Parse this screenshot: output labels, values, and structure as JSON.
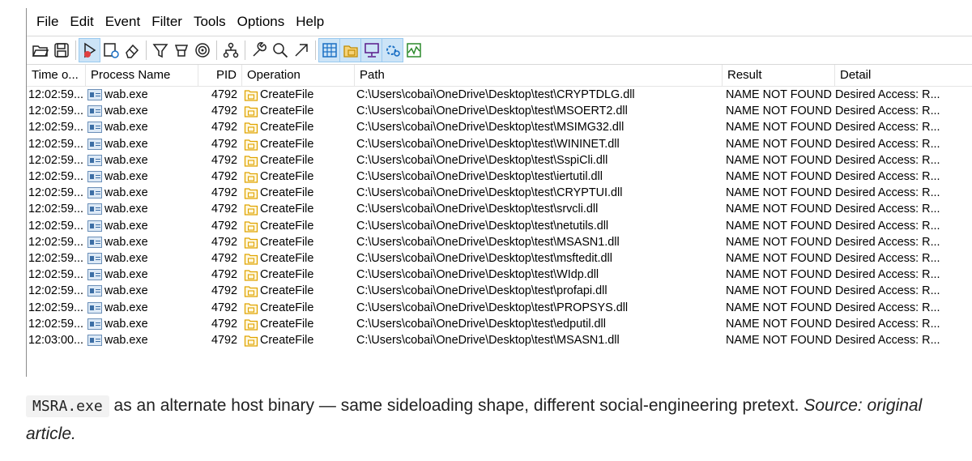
{
  "menu": [
    "File",
    "Edit",
    "Event",
    "Filter",
    "Tools",
    "Options",
    "Help"
  ],
  "toolbar": {
    "icons": [
      "open-folder-icon",
      "save-icon",
      "capture-icon",
      "autoscroll-icon",
      "clear-icon",
      "filter-icon",
      "highlight-icon",
      "target-icon",
      "process-tree-icon",
      "wrench-icon",
      "find-icon",
      "jump-icon",
      "registry-activity-icon",
      "file-activity-icon",
      "network-activity-icon",
      "process-activity-icon",
      "profiling-icon"
    ]
  },
  "columns": {
    "time": "Time o...",
    "process": "Process Name",
    "pid": "PID",
    "operation": "Operation",
    "path": "Path",
    "result": "Result",
    "detail": "Detail"
  },
  "rows": [
    {
      "time": "12:02:59...",
      "process": "wab.exe",
      "pid": "4792",
      "operation": "CreateFile",
      "path": "C:\\Users\\cobai\\OneDrive\\Desktop\\test\\CRYPTDLG.dll",
      "result": "NAME NOT FOUND",
      "detail": "Desired Access: R..."
    },
    {
      "time": "12:02:59...",
      "process": "wab.exe",
      "pid": "4792",
      "operation": "CreateFile",
      "path": "C:\\Users\\cobai\\OneDrive\\Desktop\\test\\MSOERT2.dll",
      "result": "NAME NOT FOUND",
      "detail": "Desired Access: R..."
    },
    {
      "time": "12:02:59...",
      "process": "wab.exe",
      "pid": "4792",
      "operation": "CreateFile",
      "path": "C:\\Users\\cobai\\OneDrive\\Desktop\\test\\MSIMG32.dll",
      "result": "NAME NOT FOUND",
      "detail": "Desired Access: R..."
    },
    {
      "time": "12:02:59...",
      "process": "wab.exe",
      "pid": "4792",
      "operation": "CreateFile",
      "path": "C:\\Users\\cobai\\OneDrive\\Desktop\\test\\WININET.dll",
      "result": "NAME NOT FOUND",
      "detail": "Desired Access: R..."
    },
    {
      "time": "12:02:59...",
      "process": "wab.exe",
      "pid": "4792",
      "operation": "CreateFile",
      "path": "C:\\Users\\cobai\\OneDrive\\Desktop\\test\\SspiCli.dll",
      "result": "NAME NOT FOUND",
      "detail": "Desired Access: R..."
    },
    {
      "time": "12:02:59...",
      "process": "wab.exe",
      "pid": "4792",
      "operation": "CreateFile",
      "path": "C:\\Users\\cobai\\OneDrive\\Desktop\\test\\iertutil.dll",
      "result": "NAME NOT FOUND",
      "detail": "Desired Access: R..."
    },
    {
      "time": "12:02:59...",
      "process": "wab.exe",
      "pid": "4792",
      "operation": "CreateFile",
      "path": "C:\\Users\\cobai\\OneDrive\\Desktop\\test\\CRYPTUI.dll",
      "result": "NAME NOT FOUND",
      "detail": "Desired Access: R..."
    },
    {
      "time": "12:02:59...",
      "process": "wab.exe",
      "pid": "4792",
      "operation": "CreateFile",
      "path": "C:\\Users\\cobai\\OneDrive\\Desktop\\test\\srvcli.dll",
      "result": "NAME NOT FOUND",
      "detail": "Desired Access: R..."
    },
    {
      "time": "12:02:59...",
      "process": "wab.exe",
      "pid": "4792",
      "operation": "CreateFile",
      "path": "C:\\Users\\cobai\\OneDrive\\Desktop\\test\\netutils.dll",
      "result": "NAME NOT FOUND",
      "detail": "Desired Access: R..."
    },
    {
      "time": "12:02:59...",
      "process": "wab.exe",
      "pid": "4792",
      "operation": "CreateFile",
      "path": "C:\\Users\\cobai\\OneDrive\\Desktop\\test\\MSASN1.dll",
      "result": "NAME NOT FOUND",
      "detail": "Desired Access: R..."
    },
    {
      "time": "12:02:59...",
      "process": "wab.exe",
      "pid": "4792",
      "operation": "CreateFile",
      "path": "C:\\Users\\cobai\\OneDrive\\Desktop\\test\\msftedit.dll",
      "result": "NAME NOT FOUND",
      "detail": "Desired Access: R..."
    },
    {
      "time": "12:02:59...",
      "process": "wab.exe",
      "pid": "4792",
      "operation": "CreateFile",
      "path": "C:\\Users\\cobai\\OneDrive\\Desktop\\test\\WIdp.dll",
      "result": "NAME NOT FOUND",
      "detail": "Desired Access: R..."
    },
    {
      "time": "12:02:59...",
      "process": "wab.exe",
      "pid": "4792",
      "operation": "CreateFile",
      "path": "C:\\Users\\cobai\\OneDrive\\Desktop\\test\\profapi.dll",
      "result": "NAME NOT FOUND",
      "detail": "Desired Access: R..."
    },
    {
      "time": "12:02:59...",
      "process": "wab.exe",
      "pid": "4792",
      "operation": "CreateFile",
      "path": "C:\\Users\\cobai\\OneDrive\\Desktop\\test\\PROPSYS.dll",
      "result": "NAME NOT FOUND",
      "detail": "Desired Access: R..."
    },
    {
      "time": "12:02:59...",
      "process": "wab.exe",
      "pid": "4792",
      "operation": "CreateFile",
      "path": "C:\\Users\\cobai\\OneDrive\\Desktop\\test\\edputil.dll",
      "result": "NAME NOT FOUND",
      "detail": "Desired Access: R..."
    },
    {
      "time": "12:03:00...",
      "process": "wab.exe",
      "pid": "4792",
      "operation": "CreateFile",
      "path": "C:\\Users\\cobai\\OneDrive\\Desktop\\test\\MSASN1.dll",
      "result": "NAME NOT FOUND",
      "detail": "Desired Access: R..."
    }
  ],
  "caption": {
    "code": "MSRA.exe",
    "text": " as an alternate host binary — same sideloading shape, different social-engineering pretext. ",
    "source": "Source: original article."
  },
  "colors": {
    "accent": "#cce4f7",
    "folder": "#e0a400",
    "process_icon": "#3c6ea5"
  }
}
